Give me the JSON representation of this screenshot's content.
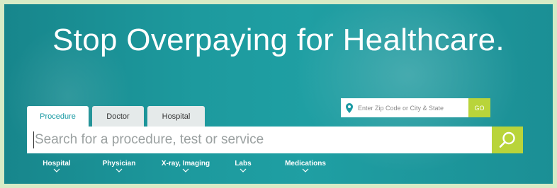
{
  "hero": {
    "headline": "Stop Overpaying for Healthcare."
  },
  "location": {
    "placeholder": "Enter Zip Code or City & State",
    "go_label": "GO"
  },
  "tabs": [
    {
      "label": "Procedure",
      "active": true
    },
    {
      "label": "Doctor",
      "active": false
    },
    {
      "label": "Hospital",
      "active": false
    }
  ],
  "search": {
    "placeholder": "Search for a procedure, test or service"
  },
  "categories": [
    {
      "label": "Hospital"
    },
    {
      "label": "Physician"
    },
    {
      "label": "X-ray, Imaging"
    },
    {
      "label": "Labs"
    },
    {
      "label": "Medications"
    }
  ],
  "colors": {
    "accent": "#b9d43a",
    "teal": "#1d9a9e",
    "active_tab_text": "#1a9aa3"
  },
  "icons": {
    "location": "map-pin-icon",
    "search": "magnifier-icon",
    "category_expand": "chevron-down-icon"
  }
}
